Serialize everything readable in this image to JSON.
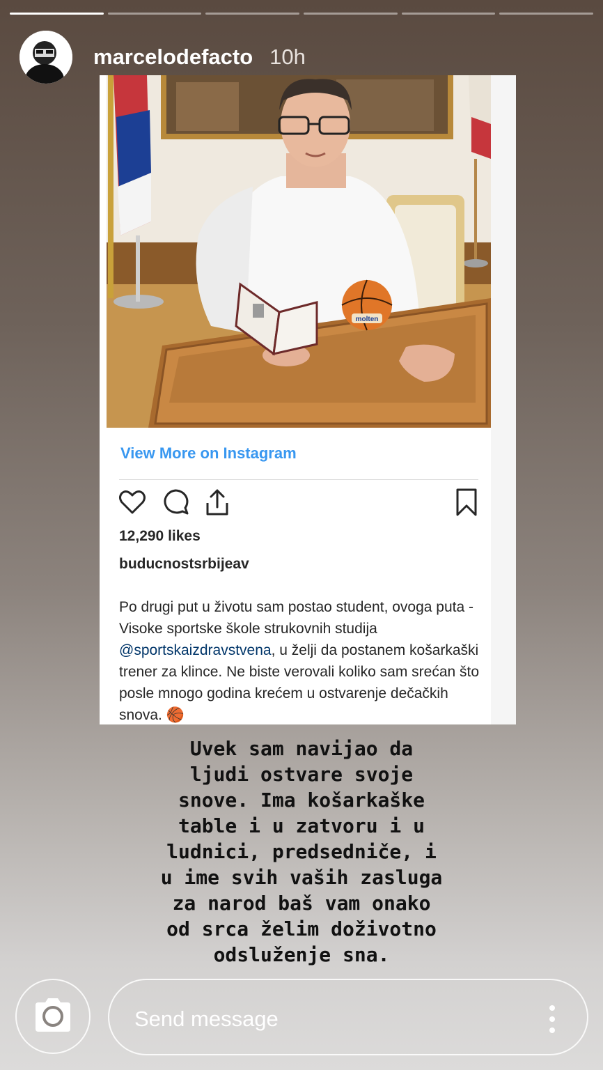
{
  "story": {
    "progress": [
      1,
      0,
      0,
      0,
      0,
      0
    ],
    "username": "marcelodefacto",
    "time": "10h"
  },
  "embed": {
    "view_more": "View More on Instagram",
    "likes": "12,290 likes",
    "account": "buducnostsrbijeav",
    "caption_before": "Po drugi put u životu sam postao student, ovoga puta - Visoke sportske škole strukovnih studija ",
    "mention": "@sportskaizdravstvena",
    "caption_after": ", u želji da postanem košarkaški trener za klince. Ne biste verovali koliko sam srećan što posle mnogo godina krećem u ostvarenje dečačkih snova. 🏀",
    "ball_label": "molten"
  },
  "overlay_text": "Uvek sam navijao da\nljudi ostvare svoje\nsnove. Ima košarkaške\ntable i u zatvoru i u\nludnici, predsedniče, i\nu ime svih vaših zasluga\nza narod baš vam onako\nod srca želim doživotno\nodsluženje sna.",
  "bottom": {
    "message_placeholder": "Send message"
  },
  "colors": {
    "link": "#3897f0",
    "mention": "#003569"
  }
}
